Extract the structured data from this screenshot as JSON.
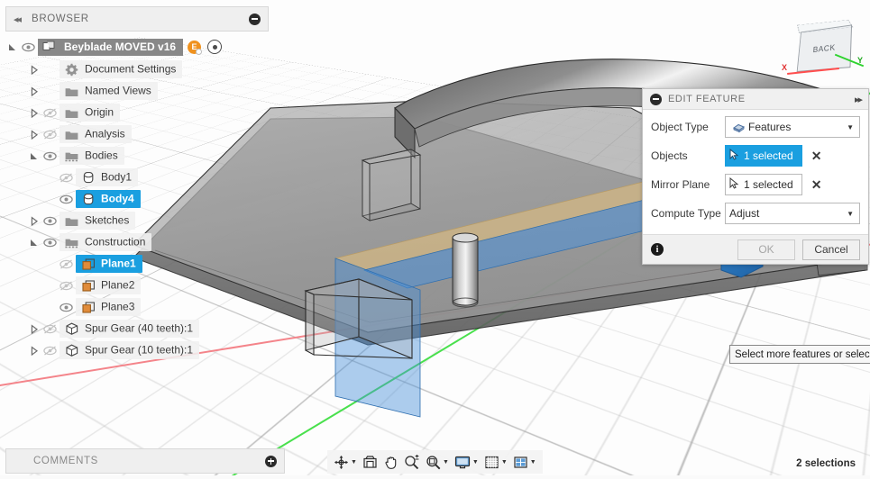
{
  "browser": {
    "title": "BROWSER",
    "collapse_icon": "chevron-double-left-icon",
    "minimize_icon": "minimize-circle-icon",
    "root": {
      "label": "Beyblade MOVED v16",
      "badge": "E",
      "doc_icon": "document-component-icon",
      "eye_icon": "eye-visible-icon",
      "target_icon": "target-icon"
    },
    "items": [
      {
        "label": "Document Settings",
        "icon": "gear-icon",
        "indent": 1,
        "arrow": "collapsed",
        "eye": "none",
        "selected": false
      },
      {
        "label": "Named Views",
        "icon": "folder-icon",
        "indent": 1,
        "arrow": "collapsed",
        "eye": "none",
        "selected": false
      },
      {
        "label": "Origin",
        "icon": "folder-icon",
        "indent": 1,
        "arrow": "collapsed",
        "eye": "hidden",
        "selected": false
      },
      {
        "label": "Analysis",
        "icon": "folder-icon",
        "indent": 1,
        "arrow": "collapsed",
        "eye": "hidden",
        "selected": false
      },
      {
        "label": "Bodies",
        "icon": "folder-dash-icon",
        "indent": 1,
        "arrow": "expanded",
        "eye": "visible",
        "selected": false
      },
      {
        "label": "Body1",
        "icon": "body-icon",
        "indent": 2,
        "arrow": "none",
        "eye": "hidden",
        "selected": false
      },
      {
        "label": "Body4",
        "icon": "body-icon",
        "indent": 2,
        "arrow": "none",
        "eye": "visible",
        "selected": true
      },
      {
        "label": "Sketches",
        "icon": "folder-icon",
        "indent": 1,
        "arrow": "collapsed",
        "eye": "visible",
        "selected": false
      },
      {
        "label": "Construction",
        "icon": "folder-dash-icon",
        "indent": 1,
        "arrow": "expanded",
        "eye": "visible",
        "selected": false
      },
      {
        "label": "Plane1",
        "icon": "plane-icon",
        "indent": 2,
        "arrow": "none",
        "eye": "hidden",
        "selected": true
      },
      {
        "label": "Plane2",
        "icon": "plane-icon",
        "indent": 2,
        "arrow": "none",
        "eye": "hidden",
        "selected": false
      },
      {
        "label": "Plane3",
        "icon": "plane-icon",
        "indent": 2,
        "arrow": "none",
        "eye": "visible",
        "selected": false
      },
      {
        "label": "Spur Gear (40 teeth):1",
        "icon": "component-icon",
        "indent": 1,
        "arrow": "collapsed",
        "eye": "hidden",
        "selected": false
      },
      {
        "label": "Spur Gear (10 teeth):1",
        "icon": "component-icon",
        "indent": 1,
        "arrow": "collapsed",
        "eye": "hidden",
        "selected": false
      }
    ]
  },
  "comments": {
    "title": "COMMENTS",
    "add_icon": "plus-circle-icon"
  },
  "dialog": {
    "title": "EDIT FEATURE",
    "collapse_icon": "minimize-circle-icon",
    "expand_icon": "chevron-double-right-icon",
    "rows": [
      {
        "label": "Object Type",
        "type": "combo",
        "value": "Features",
        "icon": "features-icon",
        "active": false
      },
      {
        "label": "Objects",
        "type": "selection",
        "value": "1 selected",
        "icon": "cursor-arrow-icon",
        "active": true
      },
      {
        "label": "Mirror Plane",
        "type": "selection",
        "value": "1 selected",
        "icon": "cursor-arrow-icon",
        "active": false
      },
      {
        "label": "Compute Type",
        "type": "combo",
        "value": "Adjust",
        "icon": "none",
        "active": false
      }
    ],
    "clear_icon": "clear-x-icon",
    "info_icon": "info-icon",
    "ok_label": "OK",
    "ok_disabled": true,
    "cancel_label": "Cancel"
  },
  "tooltip": {
    "text": "Select more features or selec"
  },
  "viewcube": {
    "face_label": "BACK",
    "axis_x_label": "X",
    "axis_y_label": "Y"
  },
  "navbar": {
    "items": [
      {
        "name": "orbit-icon",
        "caret": true
      },
      {
        "name": "look-at-icon",
        "caret": false
      },
      {
        "name": "pan-hand-icon",
        "caret": false
      },
      {
        "name": "zoom-window-icon",
        "caret": false
      },
      {
        "name": "zoom-icon",
        "caret": true
      },
      {
        "name": "display-settings-icon",
        "caret": true
      },
      {
        "name": "grid-snaps-icon",
        "caret": true
      },
      {
        "name": "viewports-icon",
        "caret": true
      }
    ]
  },
  "status": {
    "selection_count": "2 selections"
  },
  "colors": {
    "accent_blue": "#1a9fe0",
    "badge_orange": "#f0921e",
    "axis_red": "#f4848a",
    "axis_green": "#49e04d",
    "mirror_plane_blue": "#4a90d9",
    "highlight_tan": "#d6b982",
    "body_gray": "#9a9a9a"
  }
}
